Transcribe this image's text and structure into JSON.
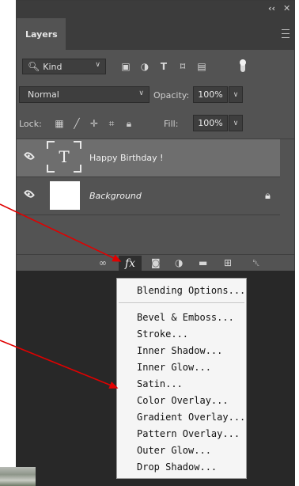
{
  "window": {
    "collapse_glyph": "‹‹",
    "close_glyph": "✕"
  },
  "tabs": {
    "layers_label": "Layers"
  },
  "filter": {
    "kind_label": "Kind",
    "icons": [
      "image-filter-icon",
      "adjustment-filter-icon",
      "type-filter-icon",
      "shape-filter-icon",
      "smart-object-filter-icon"
    ]
  },
  "blend": {
    "mode": "Normal",
    "opacity_label": "Opacity:",
    "opacity_value": "100%"
  },
  "lock": {
    "label": "Lock:",
    "fill_label": "Fill:",
    "fill_value": "100%"
  },
  "layers": [
    {
      "name": "Happy Birthday !",
      "thumb_glyph": "T",
      "selected": true
    },
    {
      "name": "Background",
      "italic": true,
      "locked": true
    }
  ],
  "bottombar": {
    "fx_label": "fx"
  },
  "effects_menu": {
    "items": [
      "Blending Options...",
      "Bevel & Emboss...",
      "Stroke...",
      "Inner Shadow...",
      "Inner Glow...",
      "Satin...",
      "Color Overlay...",
      "Gradient Overlay...",
      "Pattern Overlay...",
      "Outer Glow...",
      "Drop Shadow..."
    ]
  },
  "colors": {
    "panel": "#535353",
    "selected_row": "#6e6e6e",
    "arrow": "#e00000",
    "menu_bg": "#f5f5f5"
  }
}
